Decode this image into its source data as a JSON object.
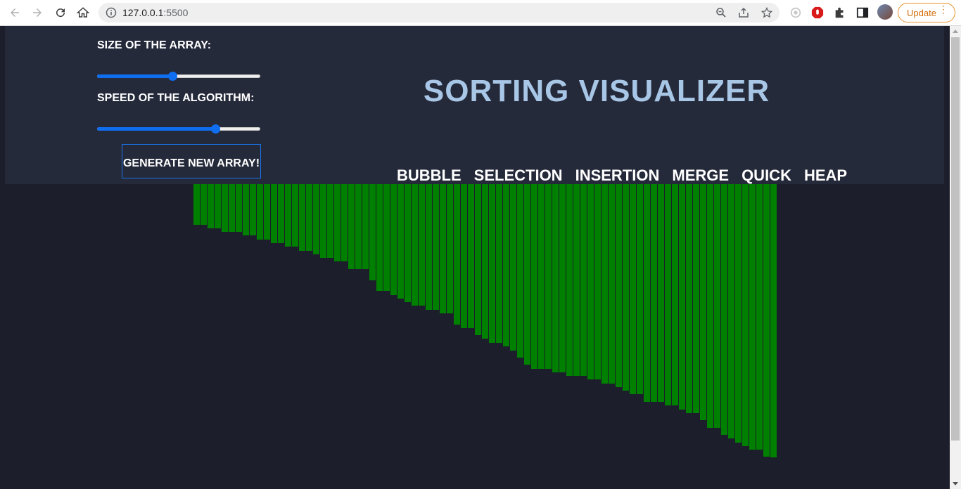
{
  "browser": {
    "url_host": "127.0.0.1",
    "url_port": ":5500",
    "update_label": "Update",
    "icons": [
      "back-arrow-icon",
      "forward-arrow-icon",
      "reload-icon",
      "home-icon",
      "site-info-icon",
      "zoom-icon",
      "share-icon",
      "bookmark-star-icon",
      "extension-icon",
      "adblock-icon",
      "puzzle-icon",
      "sidepanel-icon",
      "profile-avatar"
    ]
  },
  "controls": {
    "size_label": "SIZE OF THE ARRAY:",
    "size_value_fraction": 0.46,
    "speed_label": "SPEED OF THE ALGORITHM:",
    "speed_value_fraction": 0.74,
    "generate_label": "GENERATE NEW ARRAY!"
  },
  "title": "SORTING VISUALIZER",
  "algorithms": [
    "BUBBLE",
    "SELECTION",
    "INSERTION",
    "MERGE",
    "QUICK",
    "HEAP"
  ],
  "colors": {
    "bar": "#008000",
    "header_bg": "#252a3b",
    "page_bg": "#1c1f2b",
    "title": "#a8c6e6",
    "accent": "#0f6ef0"
  },
  "chart_data": {
    "type": "bar",
    "values": [
      58,
      58,
      63,
      63,
      68,
      68,
      68,
      73,
      73,
      79,
      79,
      84,
      84,
      89,
      89,
      95,
      95,
      100,
      105,
      105,
      110,
      110,
      121,
      121,
      121,
      137,
      152,
      152,
      158,
      163,
      168,
      173,
      173,
      179,
      179,
      184,
      184,
      200,
      205,
      205,
      215,
      220,
      226,
      226,
      231,
      237,
      247,
      257,
      263,
      263,
      263,
      268,
      268,
      273,
      273,
      273,
      278,
      278,
      284,
      284,
      289,
      294,
      299,
      299,
      310,
      310,
      310,
      315,
      315,
      321,
      326,
      326,
      336,
      347,
      347,
      357,
      362,
      368,
      373,
      378,
      378,
      388,
      389
    ],
    "ylim": [
      0,
      400
    ]
  }
}
